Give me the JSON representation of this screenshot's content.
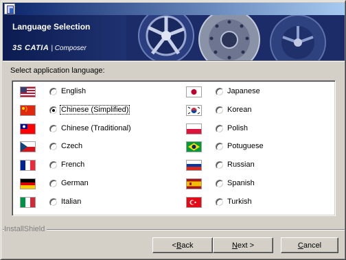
{
  "dialog": {
    "banner_title": "Language Selection",
    "brand_mark": "3S CATIA",
    "brand_sub": "| Composer",
    "prompt": "Select application language:",
    "group_label": "InstallShield"
  },
  "languages_left": [
    {
      "label": "English",
      "selected": false,
      "flag_icon": "us-flag-icon"
    },
    {
      "label": "Chinese (Simplified)",
      "selected": true,
      "flag_icon": "china-flag-icon"
    },
    {
      "label": "Chinese (Traditional)",
      "selected": false,
      "flag_icon": "taiwan-flag-icon"
    },
    {
      "label": "Czech",
      "selected": false,
      "flag_icon": "czech-flag-icon"
    },
    {
      "label": "French",
      "selected": false,
      "flag_icon": "france-flag-icon"
    },
    {
      "label": "German",
      "selected": false,
      "flag_icon": "germany-flag-icon"
    },
    {
      "label": "Italian",
      "selected": false,
      "flag_icon": "italy-flag-icon"
    }
  ],
  "languages_right": [
    {
      "label": "Japanese",
      "selected": false,
      "flag_icon": "japan-flag-icon"
    },
    {
      "label": "Korean",
      "selected": false,
      "flag_icon": "korea-flag-icon"
    },
    {
      "label": "Polish",
      "selected": false,
      "flag_icon": "poland-flag-icon"
    },
    {
      "label": "Potuguese",
      "selected": false,
      "flag_icon": "brazil-flag-icon"
    },
    {
      "label": "Russian",
      "selected": false,
      "flag_icon": "russia-flag-icon"
    },
    {
      "label": "Spanish",
      "selected": false,
      "flag_icon": "spain-flag-icon"
    },
    {
      "label": "Turkish",
      "selected": false,
      "flag_icon": "turkey-flag-icon"
    }
  ],
  "buttons": {
    "back_prefix": "< ",
    "back_key": "B",
    "back_rest": "ack",
    "next_key": "N",
    "next_rest": "ext >",
    "cancel_key": "C",
    "cancel_rest": "ancel"
  },
  "colors": {
    "title_gradient_start": "#0a246a",
    "title_gradient_end": "#a6caf0",
    "banner_bg": "#1a2a64",
    "window_bg": "#d4d0c8"
  }
}
